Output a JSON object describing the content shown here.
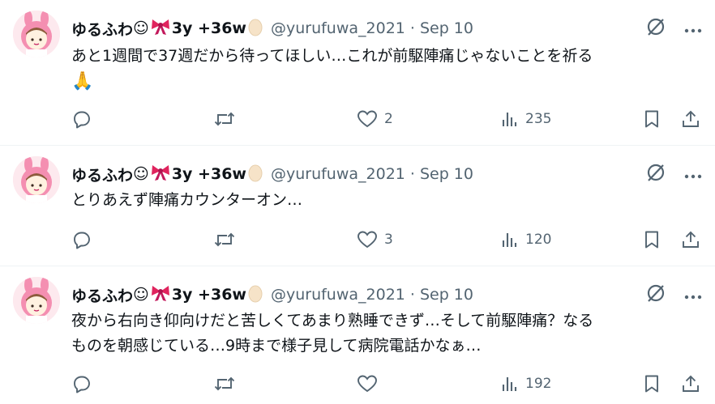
{
  "tweets": [
    {
      "name": "ゆるふわ",
      "smile": "☺",
      "badge_suffix": "3y +36w",
      "handle": "@yurufuwa_2021",
      "separator": "·",
      "time": "Sep 10",
      "text_lines": [
        "あと1週間で37週だから待ってほしい…これが前駆陣痛じゃないことを祈る",
        "🙏"
      ],
      "likes": "2",
      "views": "235"
    },
    {
      "name": "ゆるふわ",
      "smile": "☺",
      "badge_suffix": "3y +36w",
      "handle": "@yurufuwa_2021",
      "separator": "·",
      "time": "Sep 10",
      "text_lines": [
        "とりあえず陣痛カウンターオン…"
      ],
      "likes": "3",
      "views": "120"
    },
    {
      "name": "ゆるふわ",
      "smile": "☺",
      "badge_suffix": "3y +36w",
      "handle": "@yurufuwa_2021",
      "separator": "·",
      "time": "Sep 10",
      "text_lines": [
        "夜から右向き仰向けだと苦しくてあまり熟睡できず…そして前駆陣痛？なる",
        "ものを朝感じている…9時まで様子見して病院電話かなぁ…"
      ],
      "likes": "",
      "views": "192"
    }
  ],
  "icons": {
    "name_ribbon": "ribbon-icon",
    "name_egg": "egg-icon",
    "grok": "grok-icon",
    "more": "more-icon",
    "reply": "reply-icon",
    "retweet": "retweet-icon",
    "like": "heart-icon",
    "views": "views-icon",
    "bookmark": "bookmark-icon",
    "share": "share-icon"
  },
  "colors": {
    "text": "#0f1419",
    "secondary": "#536471",
    "divider": "#eff3f4",
    "ribbon": "#e0245e"
  }
}
